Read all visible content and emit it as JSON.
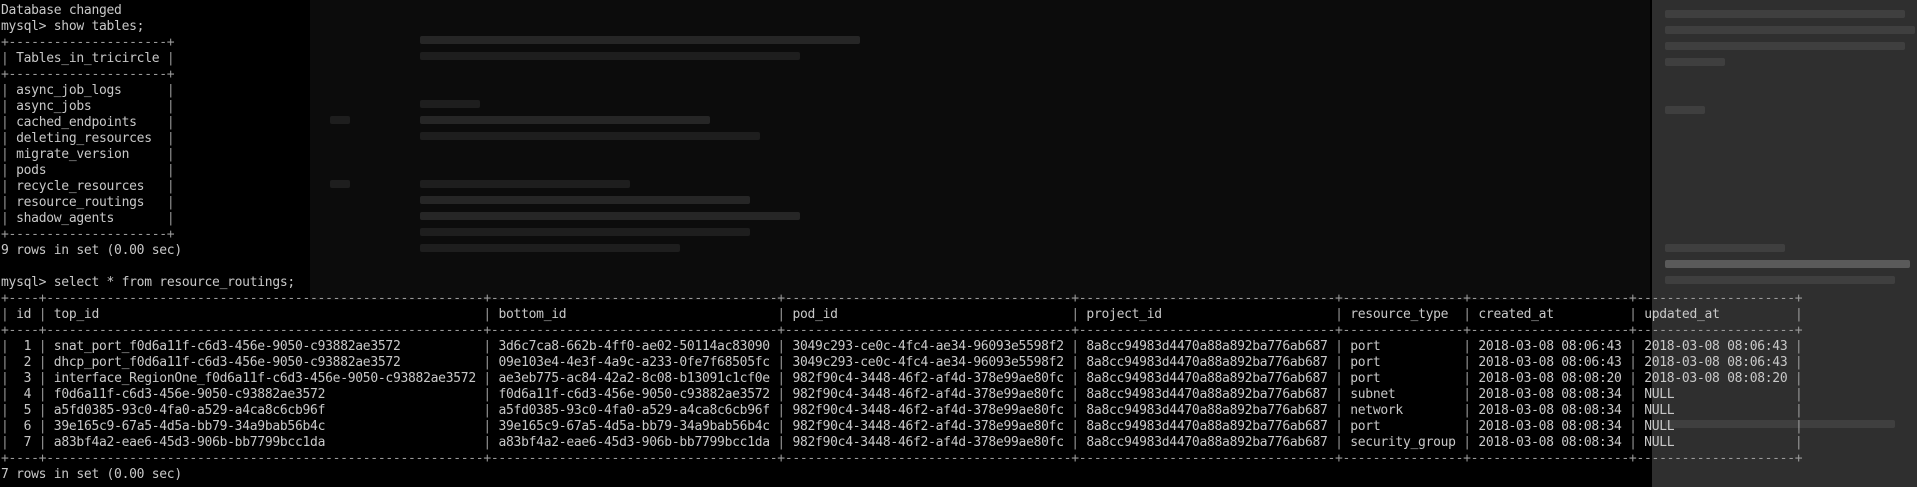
{
  "terminal": {
    "status_database": "Database changed",
    "prompt": "mysql> ",
    "command_show": "show tables;",
    "tables_header": "Tables_in_tricircle",
    "tables": [
      "async_job_logs",
      "async_jobs",
      "cached_endpoints",
      "deleting_resources",
      "migrate_version",
      "pods",
      "recycle_resources",
      "resource_routings",
      "shadow_agents"
    ],
    "tables_summary": "9 rows in set (0.00 sec)",
    "command_select": "select * from resource_routings;",
    "routings_columns": [
      "id",
      "top_id",
      "bottom_id",
      "pod_id",
      "project_id",
      "resource_type",
      "created_at",
      "updated_at"
    ],
    "routings_rows": [
      [
        "1",
        "snat_port_f0d6a11f-c6d3-456e-9050-c93882ae3572",
        "3d6c7ca8-662b-4ff0-ae02-50114ac83090",
        "3049c293-ce0c-4fc4-ae34-96093e5598f2",
        "8a8cc94983d4470a88a892ba776ab687",
        "port",
        "2018-03-08 08:06:43",
        "2018-03-08 08:06:43"
      ],
      [
        "2",
        "dhcp_port_f0d6a11f-c6d3-456e-9050-c93882ae3572",
        "09e103e4-4e3f-4a9c-a233-0fe7f68505fc",
        "3049c293-ce0c-4fc4-ae34-96093e5598f2",
        "8a8cc94983d4470a88a892ba776ab687",
        "port",
        "2018-03-08 08:06:43",
        "2018-03-08 08:06:43"
      ],
      [
        "3",
        "interface_RegionOne_f0d6a11f-c6d3-456e-9050-c93882ae3572",
        "ae3eb775-ac84-42a2-8c08-b13091c1cf0e",
        "982f90c4-3448-46f2-af4d-378e99ae80fc",
        "8a8cc94983d4470a88a892ba776ab687",
        "port",
        "2018-03-08 08:08:20",
        "2018-03-08 08:08:20"
      ],
      [
        "4",
        "f0d6a11f-c6d3-456e-9050-c93882ae3572",
        "f0d6a11f-c6d3-456e-9050-c93882ae3572",
        "982f90c4-3448-46f2-af4d-378e99ae80fc",
        "8a8cc94983d4470a88a892ba776ab687",
        "subnet",
        "2018-03-08 08:08:34",
        "NULL"
      ],
      [
        "5",
        "a5fd0385-93c0-4fa0-a529-a4ca8c6cb96f",
        "a5fd0385-93c0-4fa0-a529-a4ca8c6cb96f",
        "982f90c4-3448-46f2-af4d-378e99ae80fc",
        "8a8cc94983d4470a88a892ba776ab687",
        "network",
        "2018-03-08 08:08:34",
        "NULL"
      ],
      [
        "6",
        "39e165c9-67a5-4d5a-bb79-34a9bab56b4c",
        "39e165c9-67a5-4d5a-bb79-34a9bab56b4c",
        "982f90c4-3448-46f2-af4d-378e99ae80fc",
        "8a8cc94983d4470a88a892ba776ab687",
        "port",
        "2018-03-08 08:08:34",
        "NULL"
      ],
      [
        "7",
        "a83bf4a2-eae6-45d3-906b-bb7799bcc1da",
        "a83bf4a2-eae6-45d3-906b-bb7799bcc1da",
        "982f90c4-3448-46f2-af4d-378e99ae80fc",
        "8a8cc94983d4470a88a892ba776ab687",
        "security_group",
        "2018-03-08 08:08:34",
        "NULL"
      ]
    ],
    "routings_summary": "7 rows in set (0.00 sec)"
  },
  "colors": {
    "background": "#000000",
    "text": "#c8c8c8",
    "background_window": "#2f2f2f"
  }
}
